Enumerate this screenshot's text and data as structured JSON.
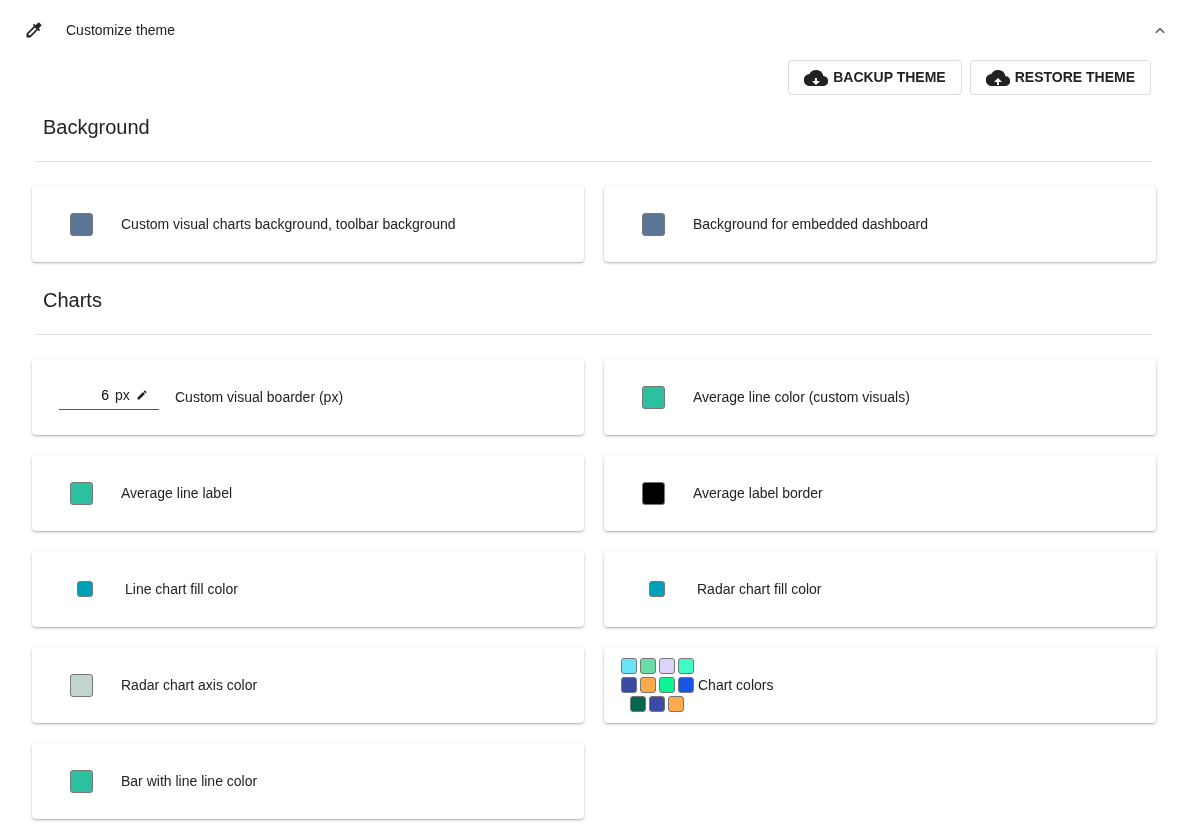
{
  "header": {
    "title": "Customize theme",
    "expanded": true
  },
  "actions": [
    {
      "label": "BACKUP THEME",
      "kind": "download"
    },
    {
      "label": "RESTORE THEME",
      "kind": "upload"
    }
  ],
  "sections": [
    {
      "title": "Background",
      "items": [
        {
          "kind": "swatch",
          "label": "Custom visual charts background, toolbar background",
          "color": "#5b7597"
        },
        {
          "kind": "swatch",
          "label": "Background for embedded dashboard",
          "color": "#5b7597"
        }
      ]
    },
    {
      "title": "Charts",
      "items": [
        {
          "kind": "number",
          "label": "Custom visual boarder (px)",
          "value": "6",
          "unit": "px"
        },
        {
          "kind": "swatch",
          "label": "Average line color (custom visuals)",
          "color": "#2bc09e"
        },
        {
          "kind": "swatch",
          "label": "Average line label",
          "color": "#2bc09e"
        },
        {
          "kind": "swatch",
          "label": "Average label border",
          "color": "#000000"
        },
        {
          "kind": "small-swatch",
          "label": "Line chart fill color",
          "color": "#00a1b8"
        },
        {
          "kind": "small-swatch",
          "label": "Radar chart fill color",
          "color": "#00a1b8"
        },
        {
          "kind": "swatch",
          "label": "Radar chart axis color",
          "color": "#c2d5cf"
        },
        {
          "kind": "palette",
          "label": "Chart colors",
          "colors": [
            {
              "color": "#6ae4f4"
            },
            {
              "color": "#6adca8"
            },
            {
              "color": "#dcd4fa"
            },
            {
              "color": "#3dfcc4"
            },
            {
              "color": "#3a4aa6"
            },
            {
              "color": "#fcaa4c"
            },
            {
              "color": "#0cf594"
            },
            {
              "color": "#1a54e4"
            },
            {
              "color": "#04664a"
            },
            {
              "color": "#3a4aa6"
            },
            {
              "color": "#fcaa4c"
            }
          ]
        },
        {
          "kind": "swatch",
          "label": "Bar with line line color",
          "color": "#2bc09e"
        }
      ]
    }
  ]
}
